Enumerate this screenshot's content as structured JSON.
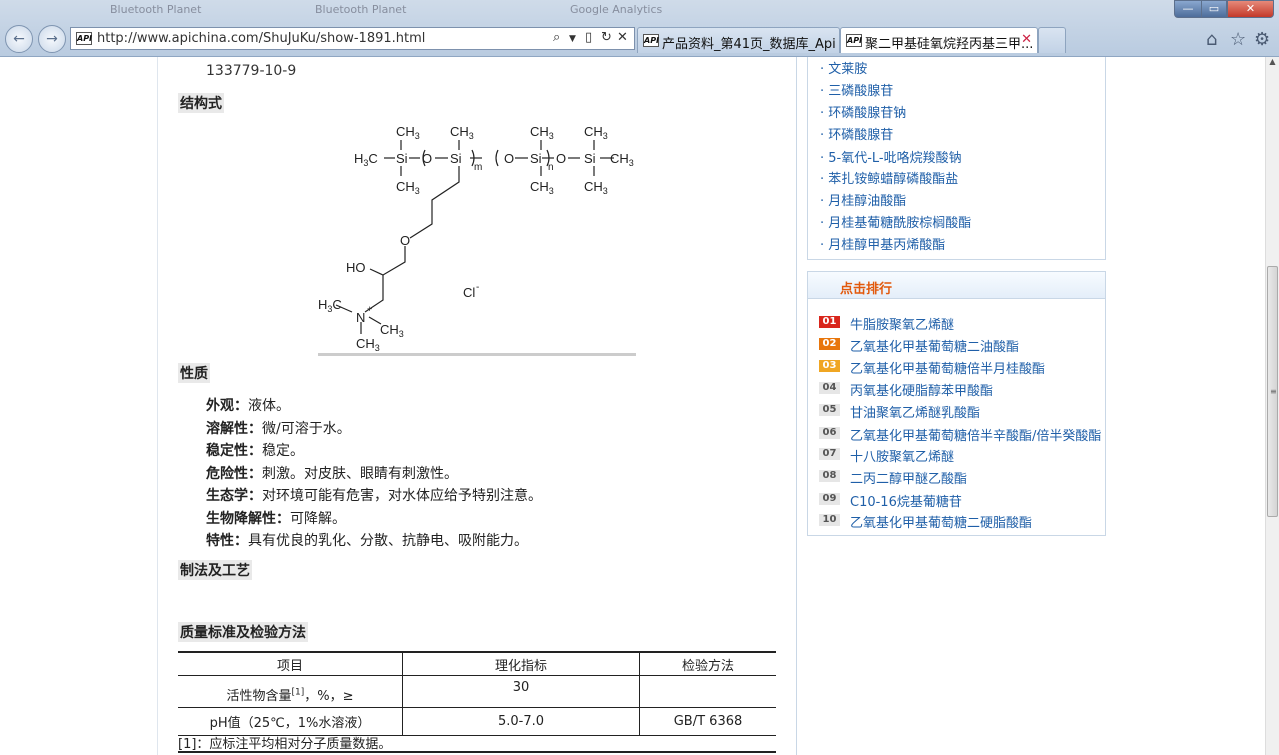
{
  "browser": {
    "ghost_tabs": [
      "Bluetooth Planet",
      "Bluetooth Planet",
      "Google Analytics"
    ],
    "address_url": "http://www.apichina.com/ShuJuKu/show-1891.html",
    "favicon_text": "API",
    "tabs": [
      {
        "label": "产品资料_第41页_数据库_Api ...",
        "active": false
      },
      {
        "label": "聚二甲基硅氧烷羟丙基三甲...",
        "active": true
      }
    ],
    "window_buttons": {
      "minimize": "—",
      "maximize": "▭",
      "close": "✕"
    }
  },
  "article": {
    "cas": "133779-10-9",
    "structure_heading": "结构式",
    "structure": {
      "ch3": "CH",
      "sub3": "3",
      "h3c": "H",
      "si": "Si",
      "o": "O",
      "m": "m",
      "n": "n",
      "ho": "HO",
      "n_plus": "N",
      "plus": "+",
      "cl": "Cl",
      "minus": "-"
    },
    "properties_heading": "性质",
    "properties": [
      {
        "label": "外观：",
        "value": "液体。"
      },
      {
        "label": "溶解性：",
        "value": "微/可溶于水。"
      },
      {
        "label": "稳定性：",
        "value": "稳定。"
      },
      {
        "label": "危险性：",
        "value": "刺激。对皮肤、眼睛有刺激性。"
      },
      {
        "label": "生态学：",
        "value": "对环境可能有危害，对水体应给予特别注意。"
      },
      {
        "label": "生物降解性：",
        "value": "可降解。"
      },
      {
        "label": "特性：",
        "value": "具有优良的乳化、分散、抗静电、吸附能力。"
      }
    ],
    "process_heading": "制法及工艺",
    "quality_heading": "质量标准及检验方法",
    "table": {
      "headers": [
        "项目",
        "理化指标",
        "检验方法"
      ],
      "rows": [
        {
          "item": "活性物含量",
          "sup": "[1]",
          "item_suffix": "，%，≥",
          "spec": "30",
          "method": ""
        },
        {
          "item": "pH值（25℃，1%水溶液）",
          "sup": "",
          "item_suffix": "",
          "spec": "5.0-7.0",
          "method": "GB/T 6368"
        }
      ],
      "note": "[1]：应标注平均相对分子质量数据。"
    }
  },
  "sidebar": {
    "related_links": [
      "· 文莱胺",
      "· 三磷酸腺苷",
      "· 环磷酸腺苷钠",
      "· 环磷酸腺苷",
      "· 5-氧代-L-吡咯烷羧酸钠",
      "· 苯扎铵鲸蜡醇磷酸酯盐",
      "· 月桂醇油酸酯",
      "· 月桂基葡糖酰胺棕榈酸酯",
      "· 月桂醇甲基丙烯酸酯"
    ],
    "ranking_title": "点击排行",
    "ranking": [
      {
        "rank": "01",
        "label": "牛脂胺聚氧乙烯醚",
        "color": "#d9261c"
      },
      {
        "rank": "02",
        "label": "乙氧基化甲基葡萄糖二油酸酯",
        "color": "#e8760c"
      },
      {
        "rank": "03",
        "label": "乙氧基化甲基葡萄糖倍半月桂酸酯",
        "color": "#f0a623"
      },
      {
        "rank": "04",
        "label": "丙氧基化硬脂醇苯甲酸酯",
        "color": "#e6e6e6"
      },
      {
        "rank": "05",
        "label": "甘油聚氧乙烯醚乳酸酯",
        "color": "#e6e6e6"
      },
      {
        "rank": "06",
        "label": "乙氧基化甲基葡萄糖倍半辛酸酯/倍半癸酸酯",
        "color": "#e6e6e6"
      },
      {
        "rank": "07",
        "label": "十八胺聚氧乙烯醚",
        "color": "#e6e6e6"
      },
      {
        "rank": "08",
        "label": "二丙二醇甲醚乙酸酯",
        "color": "#e6e6e6"
      },
      {
        "rank": "09",
        "label": "C10-16烷基葡糖苷",
        "color": "#e6e6e6"
      },
      {
        "rank": "10",
        "label": "乙氧基化甲基葡萄糖二硬脂酸酯",
        "color": "#e6e6e6"
      }
    ]
  }
}
